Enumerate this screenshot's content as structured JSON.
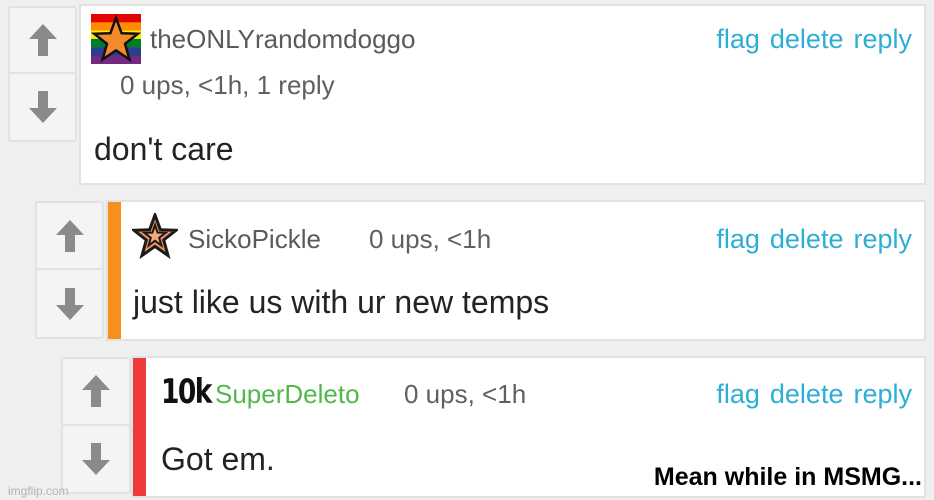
{
  "comments": [
    {
      "username": "theONLYrandomdoggo",
      "meta": "0 ups, <1h, 1 reply",
      "text": "don't care",
      "actions": {
        "flag": "flag",
        "delete": "delete",
        "reply": "reply"
      }
    },
    {
      "username": "SickoPickle",
      "meta": "0 ups, <1h",
      "text": "just like us with ur new temps",
      "thread_color": "#f5901e",
      "actions": {
        "flag": "flag",
        "delete": "delete",
        "reply": "reply"
      }
    },
    {
      "badge": "10k",
      "username": "SuperDeleto",
      "meta": "0 ups, <1h",
      "text": "Got em.",
      "thread_color": "#ef3a3a",
      "actions": {
        "flag": "flag",
        "delete": "delete",
        "reply": "reply"
      }
    }
  ],
  "caption": "Mean while in MSMG...",
  "watermark": "imgflip.com",
  "colors": {
    "link": "#2eaed6",
    "mod_username": "#52b84c"
  }
}
